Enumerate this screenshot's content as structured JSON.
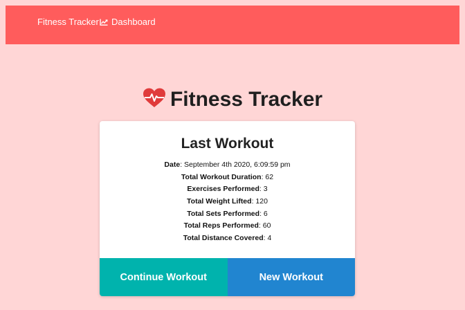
{
  "navbar": {
    "brand": "Fitness Tracker",
    "dashboard_label": "Dashboard",
    "dashboard_icon": "chart-line-icon",
    "background": "#ff5c5c"
  },
  "header": {
    "title": "Fitness Tracker",
    "icon": "heartbeat-icon",
    "icon_color": "#e03b3b"
  },
  "card": {
    "title": "Last Workout",
    "stats": [
      {
        "label": "Date",
        "value": "September 4th 2020, 6:09:59 pm"
      },
      {
        "label": "Total Workout Duration",
        "value": "62"
      },
      {
        "label": "Exercises Performed",
        "value": "3"
      },
      {
        "label": "Total Weight Lifted",
        "value": "120"
      },
      {
        "label": "Total Sets Performed",
        "value": "6"
      },
      {
        "label": "Total Reps Performed",
        "value": "60"
      },
      {
        "label": "Total Distance Covered",
        "value": "4"
      }
    ],
    "continue_label": "Continue Workout",
    "new_label": "New Workout",
    "continue_color": "#00b3ad",
    "new_color": "#2185d0"
  },
  "page_background": "#ffd6d6"
}
